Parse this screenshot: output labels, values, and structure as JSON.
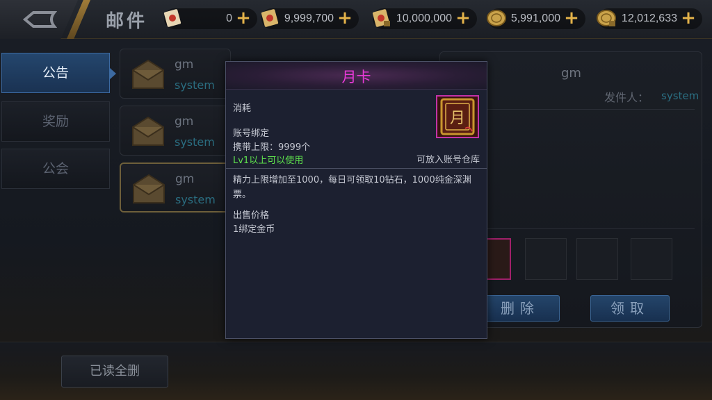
{
  "header": {
    "title": "邮件",
    "currencies": [
      {
        "icon": "ticket-scroll-icon",
        "value": "0"
      },
      {
        "icon": "gold-ticket-icon",
        "value": "9,999,700"
      },
      {
        "icon": "bound-ticket-icon",
        "value": "10,000,000"
      },
      {
        "icon": "gold-coin-icon",
        "value": "5,991,000"
      },
      {
        "icon": "bound-coin-icon",
        "value": "12,012,633"
      }
    ]
  },
  "tabs": [
    {
      "label": "公告",
      "active": true
    },
    {
      "label": "奖励",
      "active": false
    },
    {
      "label": "公会",
      "active": false
    }
  ],
  "mails": [
    {
      "sender": "gm",
      "type": "system"
    },
    {
      "sender": "gm",
      "type": "system"
    },
    {
      "sender": "gm",
      "type": "system"
    }
  ],
  "detail": {
    "sender": "gm",
    "from_label": "发件人：",
    "from_value": "system",
    "delete_label": "删除",
    "claim_label": "领取"
  },
  "bottom": {
    "read_delete_label": "已读全删"
  },
  "popup": {
    "title": "月卡",
    "consume": "消耗",
    "bind": "账号绑定",
    "limit": "携带上限：9999个",
    "level": "Lv1以上可以使用",
    "warehouse": "可放入账号仓库",
    "description": "精力上限增加至1000，每日可领取10钻石，1000纯金深渊票。",
    "price_label": "出售价格",
    "price_value": "1绑定金币",
    "icon_glyph": "月"
  },
  "colors": {
    "popup_title": "#e93ad8",
    "level_text": "#5ee24d",
    "currency_plus": "#e4b34a",
    "active_tab": "#24466d"
  }
}
